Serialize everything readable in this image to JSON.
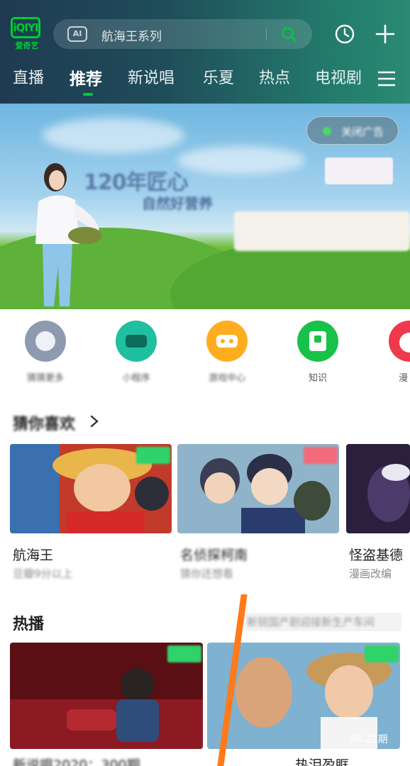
{
  "header": {
    "logo_mark": "iQIYI",
    "logo_text": "爱奇艺",
    "search_badge": "AI",
    "search_placeholder": "航海王系列",
    "accent_color": "#00cc36",
    "icons": [
      "search-icon",
      "history-icon",
      "plus-icon",
      "menu-icon"
    ]
  },
  "tabs": [
    {
      "label": "直播"
    },
    {
      "label": "推荐",
      "active": true
    },
    {
      "label": "新说唱"
    },
    {
      "label": "乐夏"
    },
    {
      "label": "热点"
    },
    {
      "label": "电视剧"
    }
  ],
  "banner": {
    "ad_button_label": "关闭广告",
    "headline": "120年匠心",
    "subline": "自然好营养"
  },
  "shortcuts": [
    {
      "label": "猜猜更多",
      "color": "#8d9aaf"
    },
    {
      "label": "小程序",
      "color": "#1fbf9f"
    },
    {
      "label": "游戏中心",
      "color": "#ffad1f"
    },
    {
      "label": "知识",
      "color": "#18c24a"
    },
    {
      "label": "漫",
      "color": "#ee3a4c"
    }
  ],
  "guess_section": {
    "title": "猜你喜欢",
    "cards": [
      {
        "title": "航海王",
        "subtitle": "豆瓣9分以上"
      },
      {
        "title": "名侦探柯南",
        "subtitle": "猜你还想看"
      },
      {
        "title": "怪盗基德",
        "subtitle": "漫画改编"
      }
    ]
  },
  "hot_section": {
    "title": "热播",
    "right_text": "新锐国产剧迎接新生产车间",
    "cards": [
      {
        "title": "新说唱2020：300期"
      },
      {
        "title": "热泪盈眶",
        "episode_label": "08-22期"
      }
    ]
  }
}
